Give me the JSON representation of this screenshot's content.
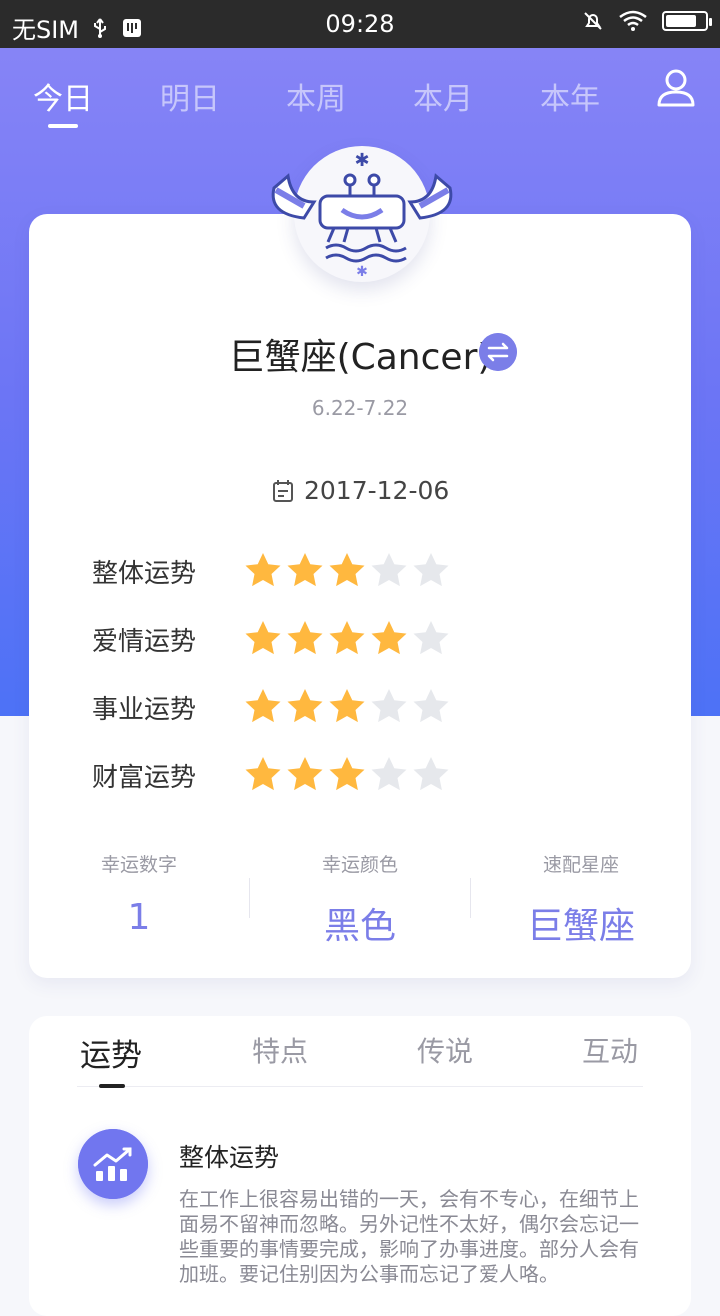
{
  "status_bar": {
    "carrier": "无SIM",
    "time": "09:28",
    "battery_level": 0.8
  },
  "top_tabs": [
    {
      "label": "今日",
      "active": true
    },
    {
      "label": "明日",
      "active": false
    },
    {
      "label": "本周",
      "active": false
    },
    {
      "label": "本月",
      "active": false
    },
    {
      "label": "本年",
      "active": false
    }
  ],
  "sign": {
    "name": "巨蟹座(Cancer)",
    "date_range": "6.22-7.22",
    "date": "2017-12-06",
    "icon": "crab-zodiac-icon"
  },
  "ratings": [
    {
      "label": "整体运势",
      "stars": 3,
      "max": 5
    },
    {
      "label": "爱情运势",
      "stars": 4,
      "max": 5
    },
    {
      "label": "事业运势",
      "stars": 3,
      "max": 5
    },
    {
      "label": "财富运势",
      "stars": 3,
      "max": 5
    }
  ],
  "lucky": {
    "number": {
      "title": "幸运数字",
      "value": "1"
    },
    "color": {
      "title": "幸运颜色",
      "value": "黑色"
    },
    "match": {
      "title": "速配星座",
      "value": "巨蟹座"
    }
  },
  "detail_tabs": [
    {
      "label": "运势",
      "active": true
    },
    {
      "label": "特点",
      "active": false
    },
    {
      "label": "传说",
      "active": false
    },
    {
      "label": "互动",
      "active": false
    }
  ],
  "section": {
    "title": "整体运势",
    "text": "在工作上很容易出错的一天，会有不专心，在细节上面易不留神而忽略。另外记性不太好，偶尔会忘记一些重要的事情要完成，影响了办事进度。部分人会有加班。要记住别因为公事而忘记了爱人咯。"
  },
  "colors": {
    "accent": "#7b7ee8",
    "star_on": "#ffb83f",
    "star_off": "#e6e8ec",
    "hero_top": "#8a86f6",
    "hero_bottom": "#4d72f6"
  }
}
